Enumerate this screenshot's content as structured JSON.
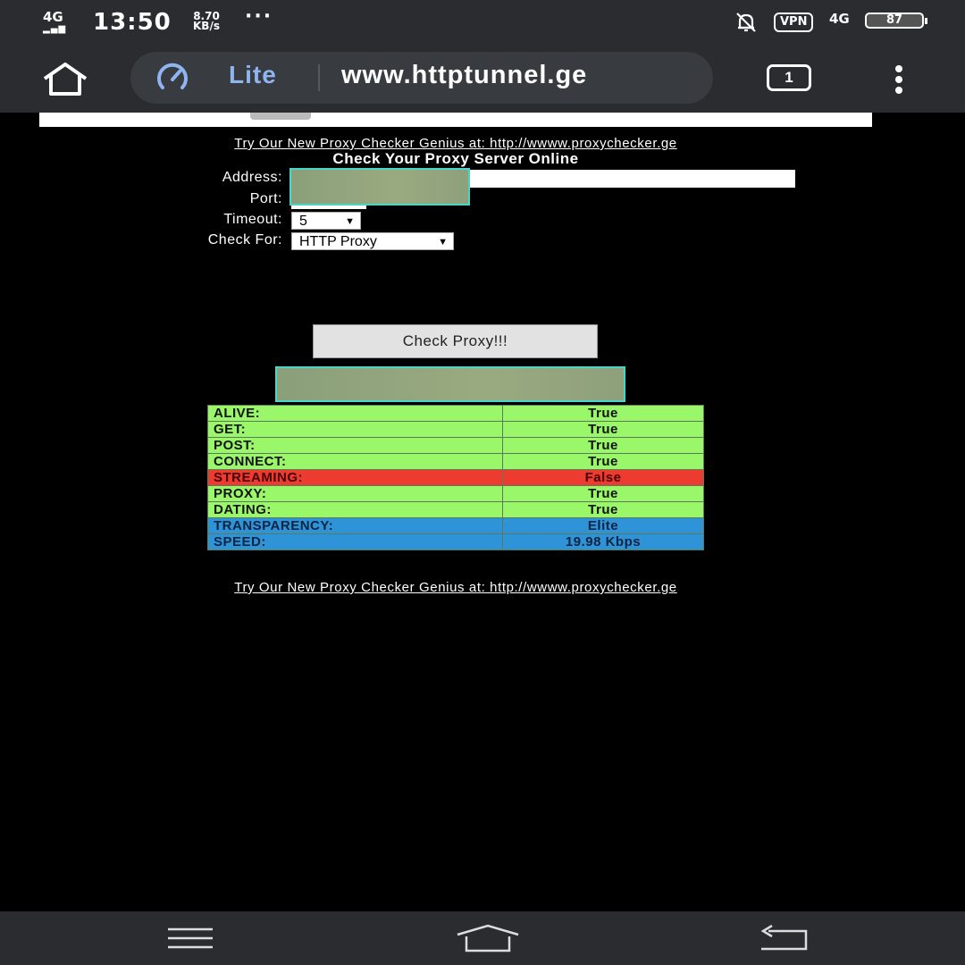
{
  "status_bar": {
    "network": "4G",
    "time": "13:50",
    "speed_value": "8.70",
    "speed_unit": "KB/s",
    "more": "···",
    "vpn": "VPN",
    "network_right": "4G",
    "battery": "87"
  },
  "browser": {
    "mode_label": "Lite",
    "url": "www.httptunnel.ge",
    "tab_count": "1"
  },
  "page": {
    "promo_link": "Try Our New Proxy Checker Genius at: http://wwww.proxychecker.ge",
    "heading": "Check Your Proxy Server Online",
    "form": {
      "address_label": "Address:",
      "port_label": "Port:",
      "timeout_label": "Timeout:",
      "timeout_value": "5",
      "check_for_label": "Check For:",
      "check_for_value": "HTTP Proxy"
    },
    "check_button": "Check Proxy!!!",
    "results": [
      {
        "label": "ALIVE:",
        "value": "True",
        "status": "green"
      },
      {
        "label": "GET:",
        "value": "True",
        "status": "green"
      },
      {
        "label": "POST:",
        "value": "True",
        "status": "green"
      },
      {
        "label": "CONNECT:",
        "value": "True",
        "status": "green"
      },
      {
        "label": "STREAMING:",
        "value": "False",
        "status": "red"
      },
      {
        "label": "PROXY:",
        "value": "True",
        "status": "green"
      },
      {
        "label": "DATING:",
        "value": "True",
        "status": "green"
      },
      {
        "label": "TRANSPARENCY:",
        "value": "Elite",
        "status": "blue"
      },
      {
        "label": "SPEED:",
        "value": "19.98 Kbps",
        "status": "blue"
      }
    ]
  },
  "colors": {
    "green": "#9af76a",
    "red": "#ee3b30",
    "blue": "#2f93d8",
    "redaction_border": "#47d6c8"
  },
  "icons": {
    "home": "home-icon",
    "lite": "speedometer-icon",
    "tabs": "tab-count-icon",
    "menu": "more-vertical-icon",
    "mute": "bell-off-icon",
    "nav_menu": "hamburger-icon",
    "nav_home": "home-outline-icon",
    "nav_back": "back-arrow-icon"
  }
}
